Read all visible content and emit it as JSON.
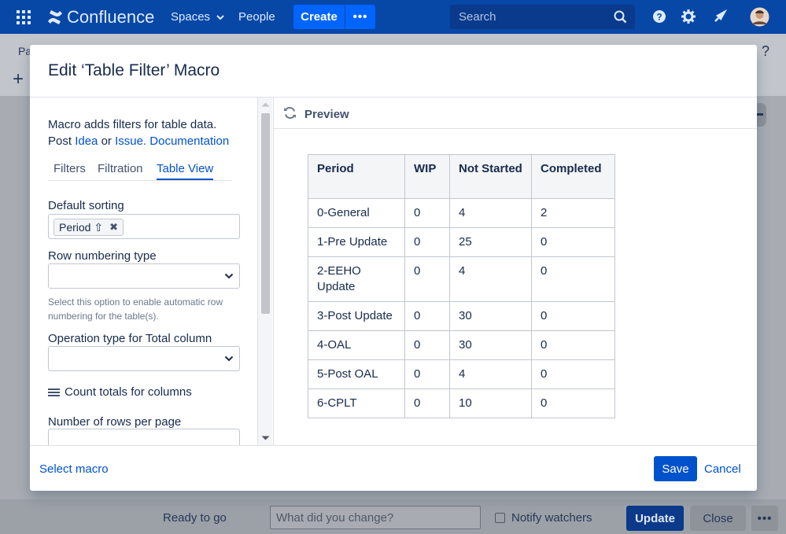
{
  "topnav": {
    "logo": "Confluence",
    "spaces": "Spaces",
    "people": "People",
    "create": "Create",
    "more": "•••",
    "search_placeholder": "Search"
  },
  "page": {
    "crumb": "Pa",
    "add": "+",
    "help": "?"
  },
  "bottombar": {
    "status": "Ready to go",
    "change_placeholder": "What did you change?",
    "notify": "Notify watchers",
    "update": "Update",
    "close": "Close",
    "more": "•••"
  },
  "dialog": {
    "title": "Edit ‘Table Filter’ Macro",
    "desc_line1": "Macro adds filters for table data.",
    "desc_post": "Post",
    "desc_idea": "Idea",
    "desc_or": "or",
    "desc_issue": "Issue.",
    "desc_docs": "Documentation",
    "tabs": [
      "Filters",
      "Filtration",
      "Table View"
    ],
    "active_tab": "Table View",
    "default_sorting_label": "Default sorting",
    "sort_chip": "Period ⇧",
    "row_numbering_label": "Row numbering type",
    "row_numbering_help": "Select this option to enable automatic row numbering for the table(s).",
    "operation_label": "Operation type for Total column",
    "count_totals": "Count totals for columns",
    "rows_per_page_label": "Number of rows per page",
    "preview_label": "Preview",
    "select_macro": "Select macro",
    "save": "Save",
    "cancel": "Cancel"
  },
  "table": {
    "headers": [
      "Period",
      "WIP",
      "Not Started",
      "Completed"
    ],
    "rows": [
      [
        "0-General",
        "0",
        "4",
        "2"
      ],
      [
        "1-Pre Update",
        "0",
        "25",
        "0"
      ],
      [
        "2-EEHO Update",
        "0",
        "4",
        "0"
      ],
      [
        "3-Post Update",
        "0",
        "30",
        "0"
      ],
      [
        "4-OAL",
        "0",
        "30",
        "0"
      ],
      [
        "5-Post OAL",
        "0",
        "4",
        "0"
      ],
      [
        "6-CPLT",
        "0",
        "10",
        "0"
      ]
    ]
  },
  "colors": {
    "nav_bg": "#0747a6",
    "primary": "#0052cc",
    "create_bg": "#0065ff",
    "text": "#172b4d"
  }
}
